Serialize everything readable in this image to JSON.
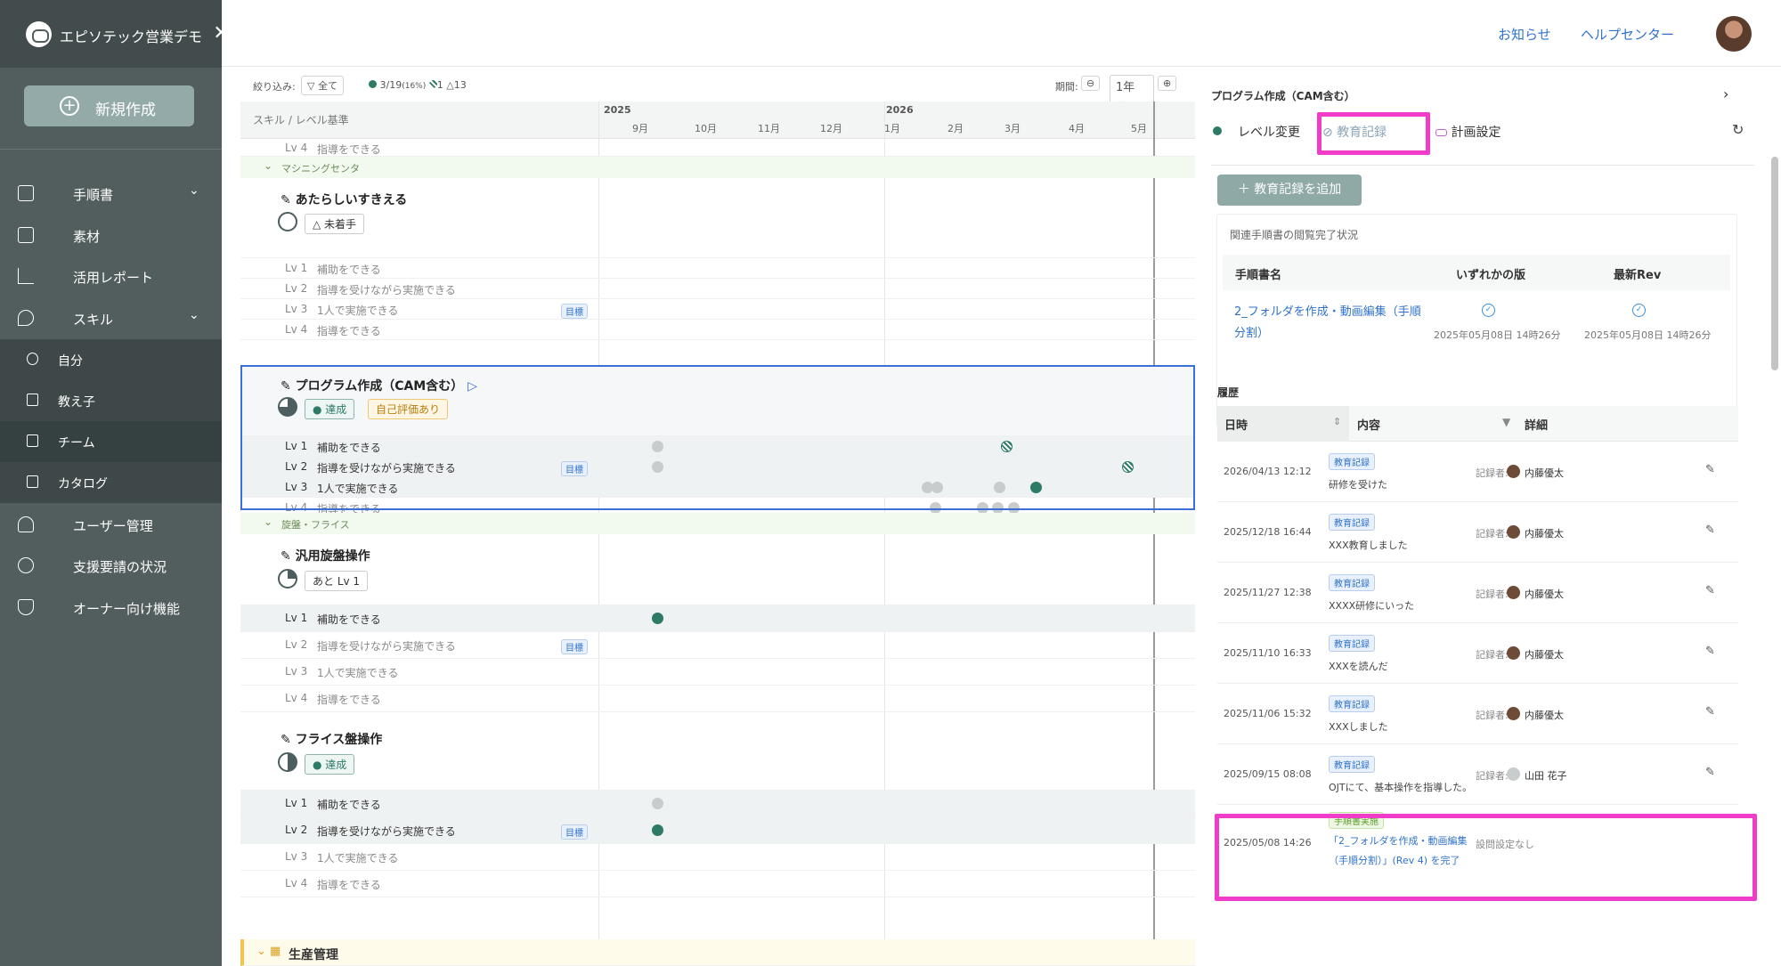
{
  "sidebar": {
    "brand": "エピソテック営業デモ",
    "new_button": "新規作成",
    "items": [
      {
        "label": "手順書",
        "icon": "document-icon"
      },
      {
        "label": "素材",
        "icon": "image-icon"
      },
      {
        "label": "活用レポート",
        "icon": "chart-icon"
      },
      {
        "label": "スキル",
        "icon": "wrench-icon"
      },
      {
        "label": "ユーザー管理",
        "icon": "users-icon"
      },
      {
        "label": "支援要請の状況",
        "icon": "alarm-icon"
      },
      {
        "label": "オーナー向け機能",
        "icon": "shield-icon"
      }
    ],
    "skill_sub": [
      {
        "label": "自分",
        "icon": "person-icon"
      },
      {
        "label": "教え子",
        "icon": "list-icon"
      },
      {
        "label": "チーム",
        "icon": "team-icon"
      },
      {
        "label": "カタログ",
        "icon": "book-icon"
      }
    ]
  },
  "topbar": {
    "news": "お知らせ",
    "help": "ヘルプセンター"
  },
  "gantt": {
    "filter_label": "絞り込み:",
    "filter_all": "全て",
    "stat_done": "3/19",
    "stat_pct": "(16%)",
    "stat_self": "1",
    "stat_warn": "13",
    "period_label": "期間:",
    "period_value": "1年",
    "header_label": "スキル / レベル基準",
    "years": [
      "2025",
      "2026"
    ],
    "months": [
      "9月",
      "10月",
      "11月",
      "12月",
      "1月",
      "2月",
      "3月",
      "4月",
      "5月"
    ],
    "target_tag": "目標",
    "groups": [
      "マシニングセンタ",
      "旋盤・フライス",
      "生産管理"
    ],
    "lv_top": {
      "lv": "Lv 4",
      "text": "指導をできる"
    },
    "skills": [
      {
        "name": "あたらしいすきえる",
        "status": "未着手",
        "levels": [
          {
            "lv": "Lv 1",
            "text": "補助をできる"
          },
          {
            "lv": "Lv 2",
            "text": "指導を受けながら実施できる"
          },
          {
            "lv": "Lv 3",
            "text": "1人で実施できる"
          },
          {
            "lv": "Lv 4",
            "text": "指導をできる"
          }
        ]
      },
      {
        "name": "プログラム作成（CAM含む）",
        "status": "達成",
        "status2": "自己評価あり",
        "levels": [
          {
            "lv": "Lv 1",
            "text": "補助をできる"
          },
          {
            "lv": "Lv 2",
            "text": "指導を受けながら実施できる"
          },
          {
            "lv": "Lv 3",
            "text": "1人で実施できる"
          },
          {
            "lv": "Lv 4",
            "text": "指導をできる"
          }
        ]
      },
      {
        "name": "汎用旋盤操作",
        "status": "あと Lv 1",
        "levels": [
          {
            "lv": "Lv 1",
            "text": "補助をできる"
          },
          {
            "lv": "Lv 2",
            "text": "指導を受けながら実施できる"
          },
          {
            "lv": "Lv 3",
            "text": "1人で実施できる"
          },
          {
            "lv": "Lv 4",
            "text": "指導をできる"
          }
        ]
      },
      {
        "name": "フライス盤操作",
        "status": "達成",
        "levels": [
          {
            "lv": "Lv 1",
            "text": "補助をできる"
          },
          {
            "lv": "Lv 2",
            "text": "指導を受けながら実施できる"
          },
          {
            "lv": "Lv 3",
            "text": "1人で実施できる"
          },
          {
            "lv": "Lv 4",
            "text": "指導をできる"
          }
        ]
      }
    ]
  },
  "panel": {
    "title": "プログラム作成（CAM含む）",
    "tabs": [
      "レベル変更",
      "教育記録",
      "計画設定"
    ],
    "add_button": "教育記録を追加",
    "status_caption": "関連手順書の閲覧完了状況",
    "col_name": "手順書名",
    "col_any": "いずれかの版",
    "col_latest": "最新Rev",
    "doc_name": "2_フォルダを作成・動画編集（手順分割）",
    "any_time": "2025年05月08日 14時26分",
    "latest_time": "2025年05月08日 14時26分",
    "history_label": "履歴",
    "h_col_date": "日時",
    "h_col_content": "内容",
    "h_col_detail": "詳細",
    "recorder_label": "記録者:",
    "history": [
      {
        "date": "2026/04/13 12:12",
        "tag": "教育記録",
        "content": "研修を受けた",
        "recorder": "内藤優太"
      },
      {
        "date": "2025/12/18 16:44",
        "tag": "教育記録",
        "content": "XXX教育しました",
        "recorder": "内藤優太"
      },
      {
        "date": "2025/11/27 12:38",
        "tag": "教育記録",
        "content": "XXXX研修にいった",
        "recorder": "内藤優太"
      },
      {
        "date": "2025/11/10 16:33",
        "tag": "教育記録",
        "content": "XXXを読んだ",
        "recorder": "内藤優太"
      },
      {
        "date": "2025/11/06 15:32",
        "tag": "教育記録",
        "content": "XXXしました",
        "recorder": "内藤優太"
      },
      {
        "date": "2025/09/15 08:08",
        "tag": "教育記録",
        "content": "OJTにて、基本操作を指導した。",
        "recorder": "山田 花子"
      }
    ],
    "last_row": {
      "date": "2025/05/08 14:26",
      "tag": "手順書実施",
      "content": "「2_フォルダを作成・動画編集（手順分割）」(Rev 4) を完了",
      "detail": "設問設定なし"
    }
  }
}
